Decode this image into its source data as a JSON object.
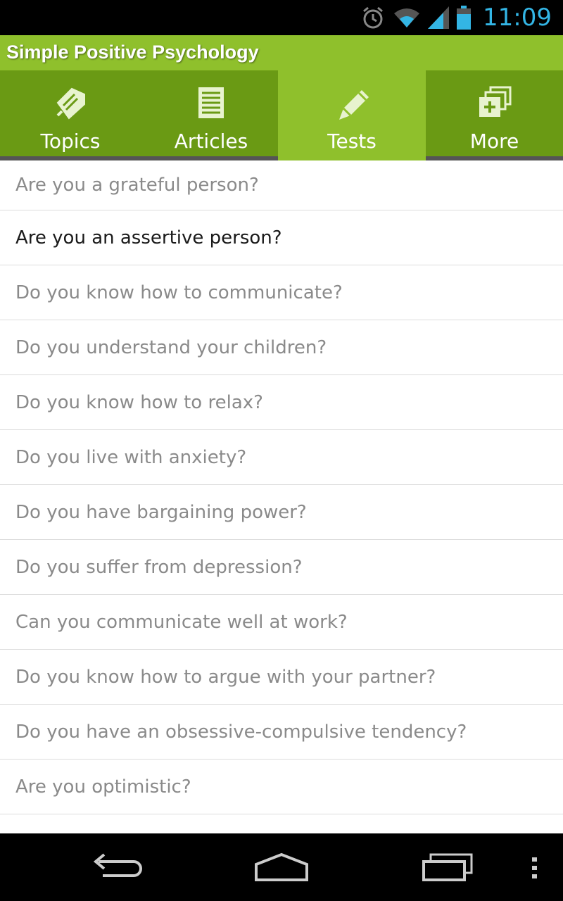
{
  "status_bar": {
    "time": "11:09",
    "icons": [
      "alarm-icon",
      "wifi-icon",
      "signal-icon",
      "battery-icon"
    ],
    "clock_color": "#33b5e5"
  },
  "app": {
    "title": "Simple Positive Psychology",
    "accent": "#8fc02c",
    "tab_bar_color": "#6a9a14"
  },
  "tabs": [
    {
      "label": "Topics",
      "icon": "pencil-tag-icon",
      "selected": false
    },
    {
      "label": "Articles",
      "icon": "document-icon",
      "selected": false
    },
    {
      "label": "Tests",
      "icon": "pencil-icon",
      "selected": true
    },
    {
      "label": "More",
      "icon": "add-stack-icon",
      "selected": false
    }
  ],
  "tests": [
    "Are you a grateful person?",
    "Are you an assertive person?",
    "Do you know how to communicate?",
    "Do you understand your children?",
    "Do you know how to relax?",
    "Do you live with anxiety?",
    "Do you have bargaining power?",
    "Do you suffer from depression?",
    "Can you communicate well at work?",
    "Do you know how to argue with your partner?",
    "Do you have an obsessive-compulsive tendency?",
    "Are you optimistic?"
  ],
  "nav": [
    "back-icon",
    "home-icon",
    "recent-apps-icon",
    "overflow-menu-icon"
  ]
}
